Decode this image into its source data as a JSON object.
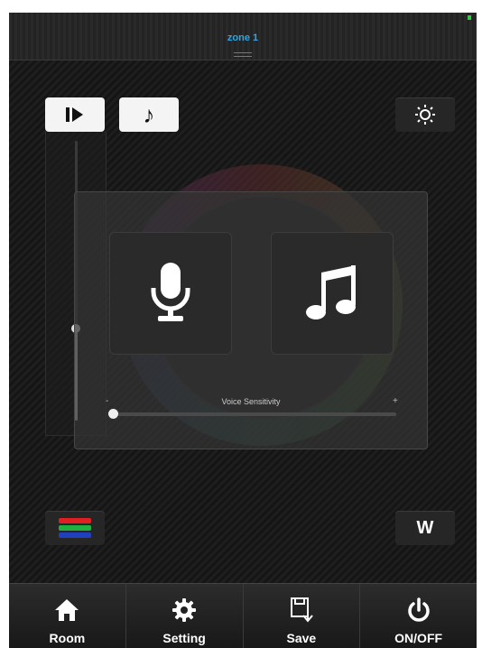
{
  "header": {
    "zone_title": "zone 1"
  },
  "top_buttons": {
    "play_icon": "play-bar-icon",
    "note_icon": "music-note-icon",
    "note_glyph": "♪",
    "brightness_icon": "brightness-icon"
  },
  "brightness_slider": {
    "level": 0.33
  },
  "voice_panel": {
    "mic_icon": "microphone-icon",
    "music_icon": "music-notes-icon",
    "sensitivity_label": "Voice Sensitivity",
    "minus_label": "-",
    "plus_label": "+",
    "sensitivity": 0.0
  },
  "bottom_buttons": {
    "rgb_icon": "rgb-stripes-icon",
    "w_label": "W"
  },
  "tabbar": {
    "tabs": [
      {
        "label": "Room",
        "icon": "home-icon"
      },
      {
        "label": "Setting",
        "icon": "gear-icon"
      },
      {
        "label": "Save",
        "icon": "save-disk-icon"
      },
      {
        "label": "ON/OFF",
        "icon": "power-icon"
      }
    ]
  },
  "colors": {
    "accent": "#2fa6e6",
    "rgb_red": "#e02020",
    "rgb_green": "#20b040",
    "rgb_blue": "#2040c0"
  }
}
